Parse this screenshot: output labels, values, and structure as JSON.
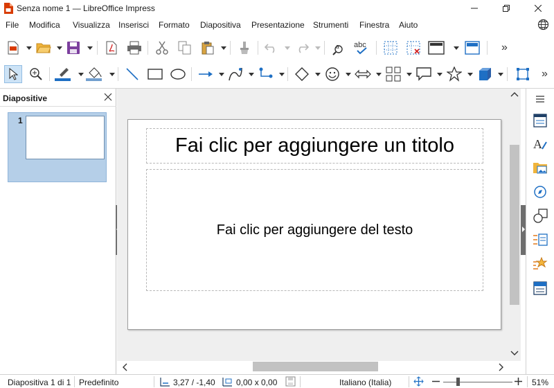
{
  "window": {
    "title": "Senza nome 1 — LibreOffice Impress"
  },
  "menu": [
    "File",
    "Modifica",
    "Visualizza",
    "Inserisci",
    "Formato",
    "Diapositiva",
    "Presentazione",
    "Strumenti",
    "Finestra",
    "Aiuto"
  ],
  "slides_pane": {
    "title": "Diapositive",
    "slides": [
      {
        "number": "1"
      }
    ]
  },
  "slide": {
    "title_placeholder": "Fai clic per aggiungere un titolo",
    "body_placeholder": "Fai clic per aggiungere del testo"
  },
  "status": {
    "slide_info": "Diapositiva 1 di 1",
    "layout": "Predefinito",
    "position": "3,27 / -1,40",
    "size": "0,00 x 0,00",
    "language": "Italiano (Italia)",
    "zoom": "51%",
    "zoom_level_percent": 51
  },
  "colors": {
    "accent_red": "#d83b01",
    "accent_blue": "#1e6fc4",
    "selection": "#cde3f6",
    "workspace": "#efefef"
  },
  "icons": {
    "toolbar1": [
      "new-document-icon",
      "open-folder-icon",
      "save-icon",
      "export-pdf-icon",
      "print-icon",
      "cut-icon",
      "copy-icon",
      "paste-icon",
      "clone-formatting-icon",
      "undo-icon",
      "redo-icon",
      "find-replace-icon",
      "spellcheck-icon",
      "grid-icon",
      "helplines-icon",
      "slide-layout-icon",
      "master-slide-icon"
    ],
    "toolbar2": [
      "select-icon",
      "zoom-pan-icon",
      "line-color-icon",
      "fill-color-icon",
      "line-icon",
      "rectangle-icon",
      "ellipse-icon",
      "arrow-line-icon",
      "curve-icon",
      "connector-icon",
      "basic-shapes-icon",
      "symbol-shapes-icon",
      "block-arrows-icon",
      "flowchart-icon",
      "callout-icon",
      "stars-icon",
      "3d-objects-icon",
      "transformations-icon"
    ],
    "deck": [
      "menu-icon",
      "properties-icon",
      "styles-icon",
      "gallery-icon",
      "navigator-icon",
      "shapes-icon",
      "slide-transition-icon",
      "animation-icon",
      "master-slides-icon"
    ]
  }
}
